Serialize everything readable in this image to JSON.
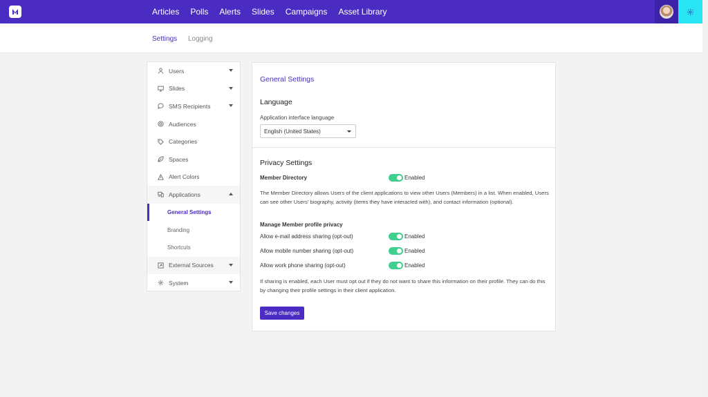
{
  "colors": {
    "brand": "#4a2cc2",
    "toggle_on": "#3fcf8e",
    "settings_button": "#27e5f2"
  },
  "topnav": {
    "items": [
      "Articles",
      "Polls",
      "Alerts",
      "Slides",
      "Campaigns",
      "Asset Library"
    ]
  },
  "subnav": {
    "tabs": [
      "Settings",
      "Logging"
    ]
  },
  "sidebar": {
    "items": [
      {
        "label": "Users",
        "icon": "user-icon",
        "caret": "down"
      },
      {
        "label": "Slides",
        "icon": "monitor-icon",
        "caret": "down"
      },
      {
        "label": "SMS Recipients",
        "icon": "chat-bubble-icon",
        "caret": "down"
      },
      {
        "label": "Audiences",
        "icon": "target-icon"
      },
      {
        "label": "Categories",
        "icon": "tag-icon"
      },
      {
        "label": "Spaces",
        "icon": "leaf-icon"
      },
      {
        "label": "Alert Colors",
        "icon": "warning-icon"
      },
      {
        "label": "Applications",
        "icon": "devices-icon",
        "caret": "up"
      }
    ],
    "sub_items": [
      "General Settings",
      "Branding",
      "Shortcuts"
    ],
    "bottom_items": [
      {
        "label": "External Sources",
        "icon": "external-icon",
        "caret": "down"
      },
      {
        "label": "System",
        "icon": "gear-icon",
        "caret": "down"
      }
    ]
  },
  "main": {
    "title": "General Settings",
    "language": {
      "heading": "Language",
      "label": "Application interface language",
      "value": "English (United States)"
    },
    "privacy": {
      "heading": "Privacy Settings",
      "member_directory": {
        "label": "Member Directory",
        "state": "Enabled"
      },
      "member_directory_desc": "The Member Directory allows Users of the client applications to view other Users (Members) in a list. When enabled, Users can see other Users' biography, activity (items they have interacted with), and contact information (optional).",
      "manage_heading": "Manage Member profile privacy",
      "options": [
        {
          "label": "Allow e-mail address sharing (opt-out)",
          "state": "Enabled"
        },
        {
          "label": "Allow mobile number sharing (opt-out)",
          "state": "Enabled"
        },
        {
          "label": "Allow work phone sharing (opt-out)",
          "state": "Enabled"
        }
      ],
      "sharing_desc": "If sharing is enabled, each User must opt out if they do not want to share this information on their profile. They can do this by changing their profile settings in their client application."
    },
    "save_label": "Save changes"
  }
}
